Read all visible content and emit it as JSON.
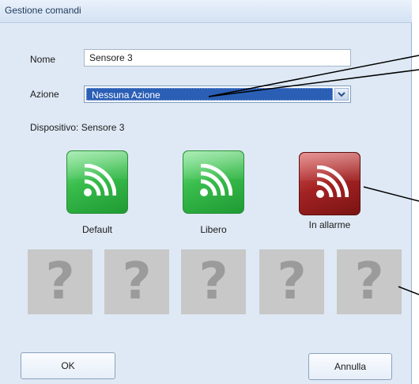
{
  "window": {
    "title": "Gestione comandi"
  },
  "form": {
    "name_label": "Nome",
    "name_value": "Sensore 3",
    "action_label": "Azione",
    "action_value": "Nessuna Azione",
    "device_text": "Dispositivo: Sensore 3"
  },
  "states": [
    {
      "label": "Default",
      "color": "green",
      "icon": "wifi-signal-icon"
    },
    {
      "label": "Libero",
      "color": "green",
      "icon": "wifi-signal-icon"
    },
    {
      "label": "In allarme",
      "color": "red",
      "icon": "wifi-signal-icon"
    }
  ],
  "placeholders": [
    {
      "glyph": "?",
      "icon": "question-mark-icon"
    },
    {
      "glyph": "?",
      "icon": "question-mark-icon"
    },
    {
      "glyph": "?",
      "icon": "question-mark-icon"
    },
    {
      "glyph": "?",
      "icon": "question-mark-icon"
    },
    {
      "glyph": "?",
      "icon": "question-mark-icon"
    }
  ],
  "buttons": {
    "ok": "OK",
    "cancel": "Annulla"
  },
  "colors": {
    "dialog_bg": "#dfe9f5",
    "state_green": "#39bd4c",
    "state_red": "#a32222",
    "selection": "#2b5fb5",
    "placeholder_bg": "#c8c8c8"
  }
}
